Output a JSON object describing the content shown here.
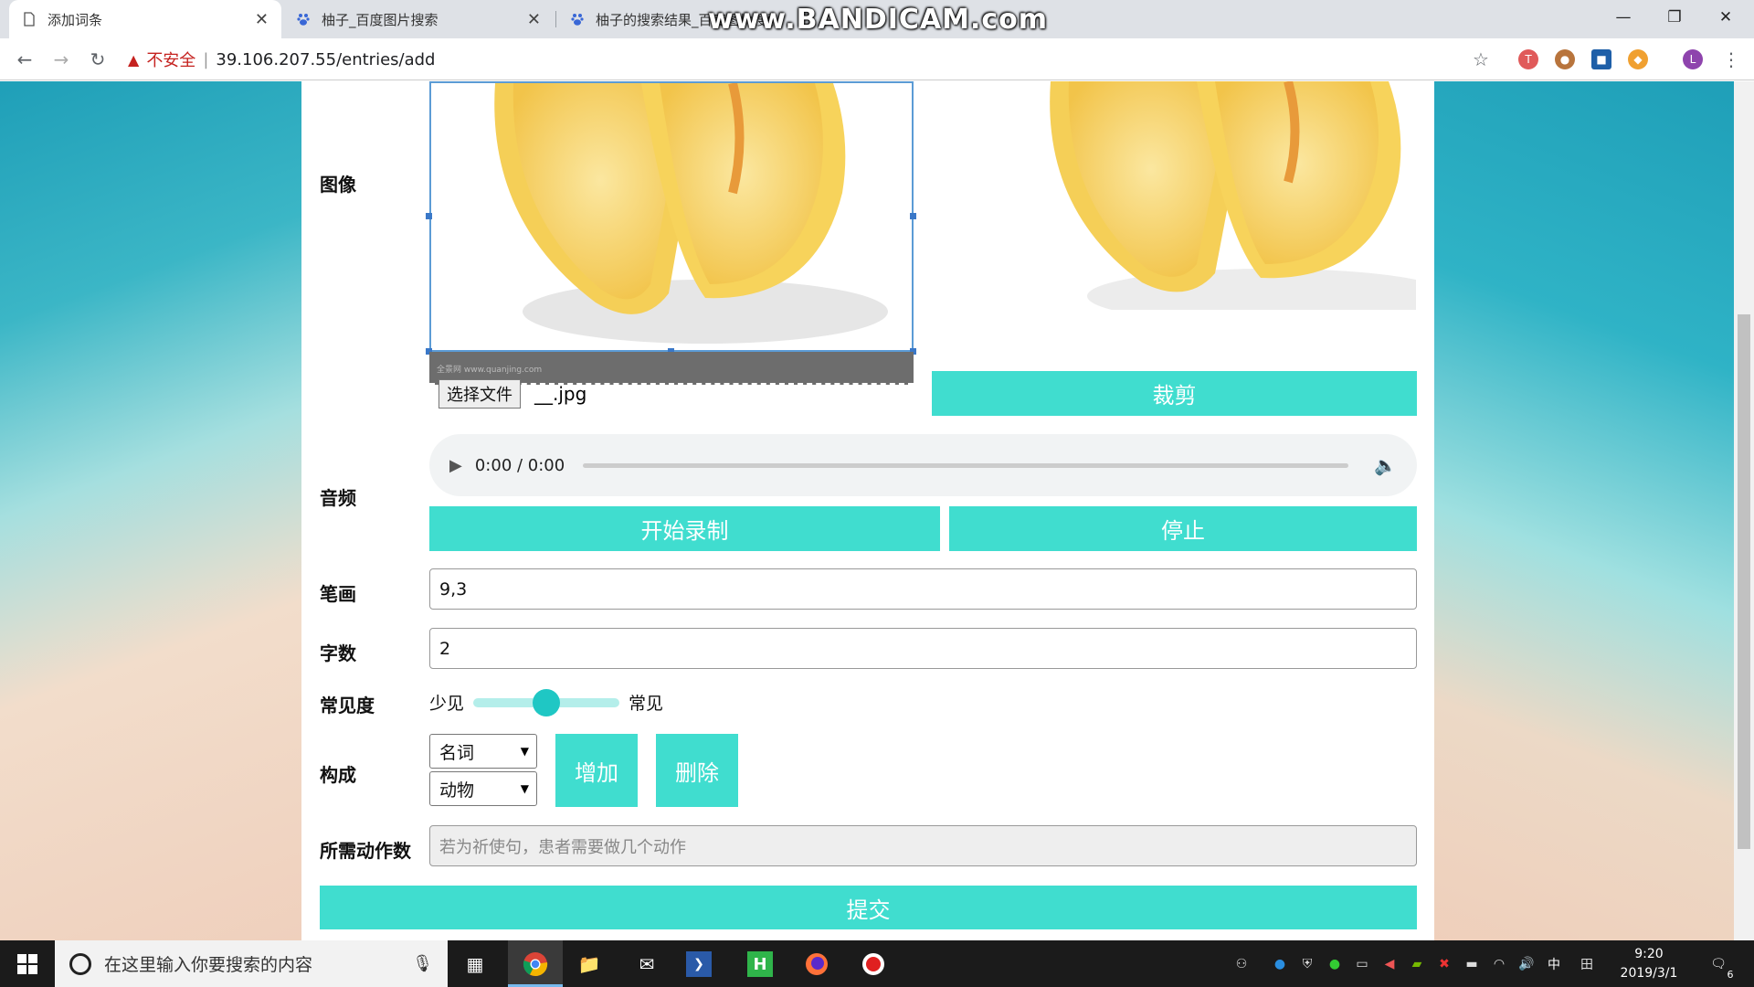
{
  "browser": {
    "tabs": [
      {
        "title": "添加词条",
        "active": true
      },
      {
        "title": "柚子_百度图片搜索",
        "active": false
      },
      {
        "title": "柚子的搜索结果_百度图片搜索",
        "active": false
      }
    ],
    "watermark": "www.BANDICAM.com",
    "security_label": "不安全",
    "url": "39.106.207.55/entries/add",
    "profile_initial": "L"
  },
  "form": {
    "image_label": "图像",
    "image_watermark": "全景网 www.quanjing.com",
    "choose_file_button": "选择文件",
    "file_name": "__.jpg",
    "crop_button": "裁剪",
    "audio_label": "音频",
    "audio_time": "0:00 / 0:00",
    "start_record_button": "开始录制",
    "stop_button": "停止",
    "strokes_label": "笔画",
    "strokes_value": "9,3",
    "char_count_label": "字数",
    "char_count_value": "2",
    "frequency_label": "常见度",
    "frequency_min_label": "少见",
    "frequency_max_label": "常见",
    "frequency_level": 0.5,
    "composition_label": "构成",
    "composition_selects": [
      "名词",
      "动物"
    ],
    "add_button": "增加",
    "delete_button": "删除",
    "actions_label": "所需动作数",
    "actions_placeholder": "若为祈使句，患者需要做几个动作",
    "submit_button": "提交"
  },
  "taskbar": {
    "search_placeholder": "在这里输入你要搜索的内容",
    "ime_label": "中",
    "time": "9:20",
    "date": "2019/3/1",
    "notification_count": "6"
  },
  "colors": {
    "accent": "#40ddcf",
    "slider_thumb": "#1fc7c4",
    "insecure_red": "#c5221f"
  }
}
